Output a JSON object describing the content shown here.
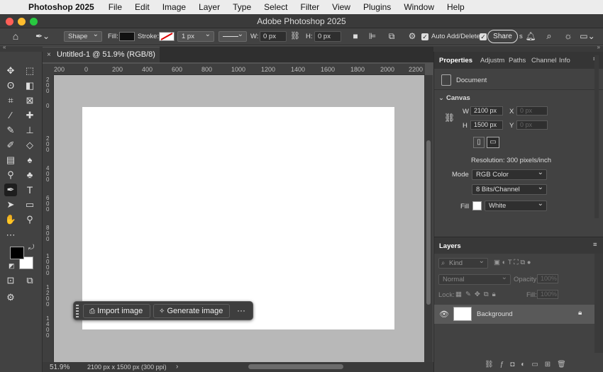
{
  "menubar": {
    "app_name": "Photoshop 2025",
    "items": [
      "File",
      "Edit",
      "Image",
      "Layer",
      "Type",
      "Select",
      "Filter",
      "View",
      "Plugins",
      "Window",
      "Help"
    ]
  },
  "window": {
    "title": "Adobe Photoshop 2025"
  },
  "options_bar": {
    "mode_value": "Shape",
    "fill_label": "Fill:",
    "stroke_label": "Stroke:",
    "stroke_width": "1 px",
    "w_label": "W:",
    "w_value": "0 px",
    "h_label": "H:",
    "h_value": "0 px",
    "auto_add_delete": "Auto Add/Delete",
    "share_label": "Share",
    "share_suffix": "s"
  },
  "document": {
    "tab_title": "Untitled-1 @ 51.9% (RGB/8) *",
    "zoom": "51.9%",
    "size_info": "2100 px x 1500 px (300 ppi)"
  },
  "ruler": {
    "h_ticks": [
      "200",
      "0",
      "200",
      "400",
      "600",
      "800",
      "1000",
      "1200",
      "1400",
      "1600",
      "1800",
      "2000",
      "2200"
    ],
    "v_ticks": [
      "2\n0\n0",
      "0",
      "2\n0\n0",
      "4\n0\n0",
      "6\n0\n0",
      "8\n0\n0",
      "1\n0\n0\n0",
      "1\n2\n0\n0",
      "1\n4\n0\n0"
    ]
  },
  "taskbar": {
    "import_label": "Import image",
    "generate_label": "Generate image",
    "more": "···"
  },
  "properties": {
    "tabs": [
      "Properties",
      "Adjustm",
      "Paths",
      "Channel",
      "Info"
    ],
    "document_label": "Document",
    "canvas_section": "Canvas",
    "w_label": "W",
    "w_value": "2100 px",
    "h_label": "H",
    "h_value": "1500 px",
    "x_label": "X",
    "x_value": "0 px",
    "y_label": "Y",
    "y_value": "0 px",
    "resolution": "Resolution: 300 pixels/inch",
    "mode_label": "Mode",
    "mode_value": "RGB Color",
    "bits_value": "8 Bits/Channel",
    "fill_label": "Fill",
    "fill_value": "White"
  },
  "layers": {
    "title": "Layers",
    "kind_label": "Kind",
    "blend_mode": "Normal",
    "opacity_label": "Opacity:",
    "opacity_value": "100%",
    "lock_label": "Lock:",
    "fill_label": "Fill:",
    "fill_value": "100%",
    "items": [
      {
        "name": "Background"
      }
    ]
  },
  "colors": {
    "accent": "#4a90d9",
    "foreground_swatch": "#000000",
    "background_swatch": "#ffffff"
  }
}
